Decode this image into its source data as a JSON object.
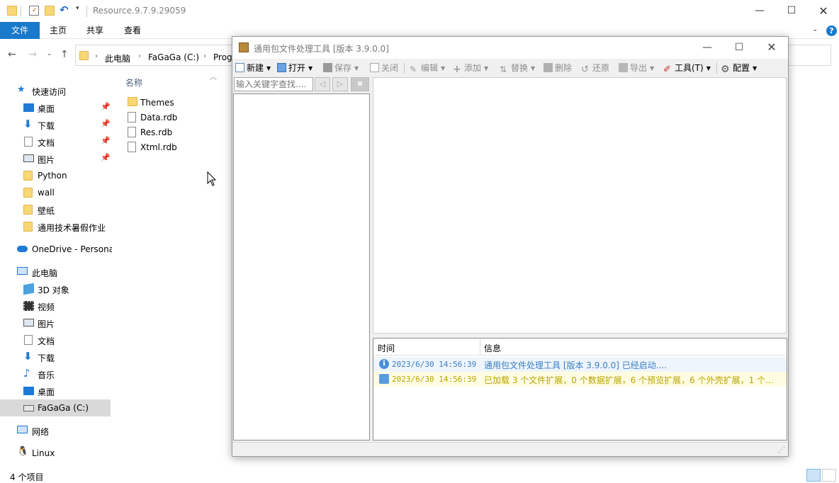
{
  "explorer": {
    "title": "Resource.9.7.9.29059",
    "ribbon_tabs": [
      "文件",
      "主页",
      "共享",
      "查看"
    ],
    "breadcrumb": [
      "此电脑",
      "FaGaGa (C:)",
      "Prog"
    ],
    "nav": {
      "quick_access": "快速访问",
      "quick_items": [
        "桌面",
        "下载",
        "文档",
        "图片",
        "Python",
        "wall",
        "壁纸",
        "通用技术暑假作业"
      ],
      "onedrive": "OneDrive - Persona",
      "this_pc": "此电脑",
      "pc_items": [
        "3D 对象",
        "视频",
        "图片",
        "文档",
        "下载",
        "音乐",
        "桌面",
        "FaGaGa (C:)"
      ],
      "network": "网络",
      "linux": "Linux"
    },
    "column_header": "名称",
    "files": [
      {
        "name": "Themes",
        "type": "folder"
      },
      {
        "name": "Data.rdb",
        "type": "file"
      },
      {
        "name": "Res.rdb",
        "type": "file"
      },
      {
        "name": "Xtml.rdb",
        "type": "file"
      }
    ],
    "status": "4 个项目"
  },
  "tool": {
    "title": "通用包文件处理工具 [版本 3.9.0.0]",
    "toolbar": {
      "new": "新建",
      "open": "打开",
      "save": "保存",
      "close": "关闭",
      "edit": "编辑",
      "add": "添加",
      "replace": "替换",
      "delete": "删除",
      "restore": "还原",
      "export": "导出",
      "tools": "工具(T)",
      "config": "配置"
    },
    "search_placeholder": "输入关键字查找....",
    "log": {
      "col_time": "时间",
      "col_info": "信息",
      "rows": [
        {
          "time": "2023/6/30 14:56:39",
          "message": "通用包文件处理工具 [版本 3.9.0.0] 已经启动....",
          "color": "#3b7fc4",
          "bg": "#eef5fc"
        },
        {
          "time": "2023/6/30 14:56:39",
          "message": "已加载 3 个文件扩展，0 个数据扩展，6 个预览扩展，6 个外壳扩展，1 个...",
          "color": "#b8a300",
          "bg": "#fefde2"
        }
      ]
    }
  }
}
